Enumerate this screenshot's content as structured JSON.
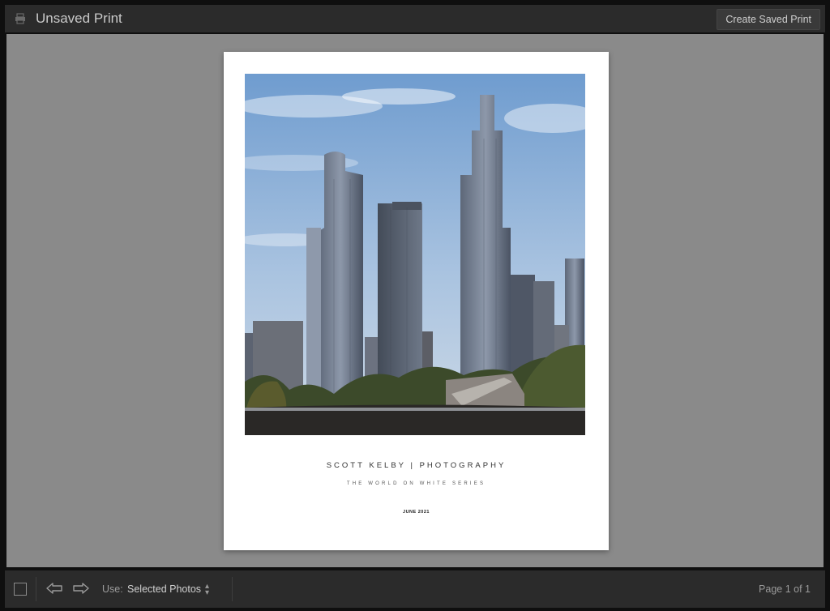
{
  "window": {
    "title": "Unsaved Print",
    "create_saved_print_label": "Create Saved Print"
  },
  "paper": {
    "caption_title": "SCOTT KELBY | PHOTOGRAPHY",
    "caption_subtitle": "THE WORLD ON WHITE SERIES",
    "caption_date": "JUNE 2021"
  },
  "toolbar": {
    "use_label": "Use:",
    "use_value": "Selected Photos",
    "page_indicator": "Page 1 of 1"
  },
  "icons": {
    "print": "print-icon",
    "view": "view-toggle-icon",
    "prev": "arrow-left-icon",
    "next": "arrow-right-icon",
    "stepper": "up-down-stepper-icon"
  },
  "colors": {
    "chrome": "#2b2b2b",
    "canvas": "#8a8a8a",
    "paper": "#ffffff",
    "sky": "#8fb1d8"
  }
}
